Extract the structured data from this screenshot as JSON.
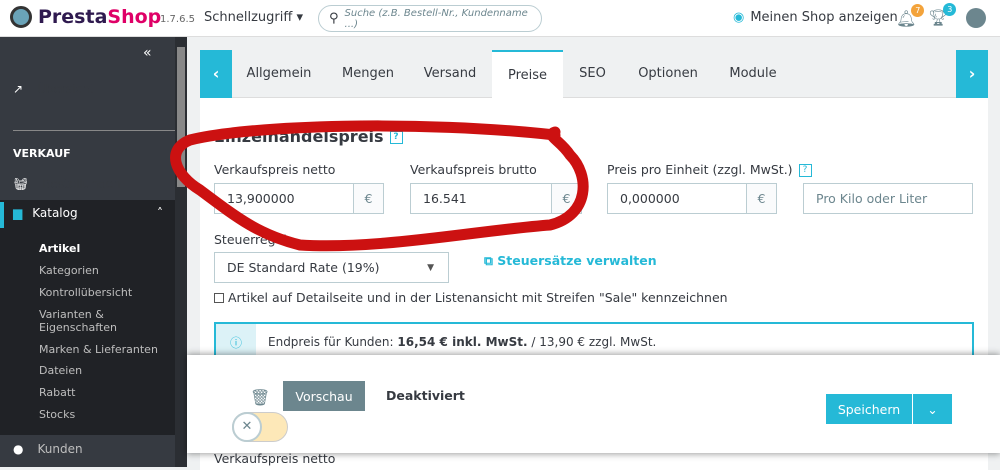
{
  "header": {
    "logo_text_a": "Presta",
    "logo_text_b": "Shop",
    "version": "1.7.6.5",
    "quick_access": "Schnellzugriff",
    "search_placeholder": "Suche (z.B. Bestell-Nr., Kundenname ...)",
    "view_shop": "Meinen Shop anzeigen",
    "notifications_count": "7",
    "trophy_count": "3"
  },
  "sidebar": {
    "overview": "Übersicht",
    "section": "VERKAUF",
    "orders": "Bestellungen",
    "catalog": "Katalog",
    "sub": [
      "Artikel",
      "Kategorien",
      "Kontrollübersicht",
      "Varianten &",
      "Eigenschaften",
      "Marken & Lieferanten",
      "Dateien",
      "Rabatt",
      "Stocks"
    ],
    "customers": "Kunden"
  },
  "tabs": [
    "Allgemein",
    "Mengen",
    "Versand",
    "Preise",
    "SEO",
    "Optionen",
    "Module"
  ],
  "pricing": {
    "title": "Einzelhandelspreis",
    "help": "?",
    "net_label": "Verkaufspreis netto",
    "net_value": "13,900000",
    "gross_label": "Verkaufspreis brutto",
    "gross_value": "16.541",
    "unit_label": "Preis pro Einheit (zzgl. MwSt.)",
    "unit_value": "0,000000",
    "unit_placeholder": "Pro Kilo oder Liter",
    "currency": "€",
    "tax_label": "Steuerregel",
    "tax_value": "DE Standard Rate (19%)",
    "manage_tax": "Steuersätze verwalten",
    "sale_checkbox": "Artikel auf Detailseite und in der Listenansicht mit Streifen \"Sale\" kennzeichnen",
    "final_prefix": "Endpreis für Kunden:",
    "final_bold": "16,54 € inkl. MwSt.",
    "final_suffix": "/ 13,90 € zzgl. MwSt.",
    "below_label": "Verkaufspreis netto"
  },
  "footer": {
    "preview": "Vorschau",
    "status": "Deaktiviert",
    "save": "Speichern"
  },
  "colors": {
    "accent": "#25b9d7",
    "sidebar": "#363a41",
    "annotation": "#cc1111"
  }
}
